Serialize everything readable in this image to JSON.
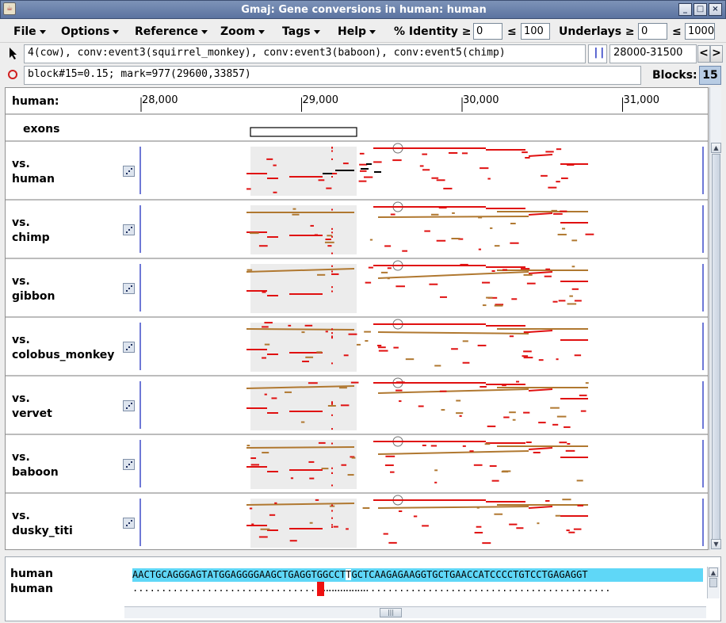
{
  "window": {
    "title": "Gmaj: Gene conversions in human: human",
    "app_icon": "java-cup-icon",
    "buttons": [
      "_",
      "□",
      "×"
    ]
  },
  "menubar": {
    "items": [
      "File",
      "Options",
      "Reference",
      "Zoom",
      "Tags",
      "Help"
    ],
    "identity": {
      "label": "% Identity",
      "ge": "≥",
      "le": "≤",
      "min": "0",
      "max": "100"
    },
    "underlays": {
      "label": "Underlays",
      "ge": "≥",
      "le": "≤",
      "min": "0",
      "max": "1000"
    }
  },
  "toolbar": {
    "info_text": "4(cow), conv:event3(squirrel_monkey), conv:event3(baboon), conv:event5(chimp)",
    "range_icon": "||",
    "range": "28000-31500",
    "prev": "<",
    "next": ">",
    "mark_text": "block#15=0.15; mark=977(29600,33857)",
    "blocks_label": "Blocks:",
    "blocks_value": "15"
  },
  "ruler": {
    "label": "human:",
    "ticks": [
      {
        "pos": 28000,
        "text": "28,000"
      },
      {
        "pos": 29000,
        "text": "29,000"
      },
      {
        "pos": 30000,
        "text": "30,000"
      },
      {
        "pos": 31000,
        "text": "31,000"
      }
    ]
  },
  "exons": {
    "label": "exons"
  },
  "rows": [
    {
      "vs": "vs.",
      "species": "human"
    },
    {
      "vs": "vs.",
      "species": "chimp"
    },
    {
      "vs": "vs.",
      "species": "gibbon"
    },
    {
      "vs": "vs.",
      "species": "colobus_monkey"
    },
    {
      "vs": "vs.",
      "species": "vervet"
    },
    {
      "vs": "vs.",
      "species": "baboon"
    },
    {
      "vs": "vs.",
      "species": "dusky_titi"
    }
  ],
  "sequence": {
    "row1_name": "human",
    "row2_name": "human",
    "seq_left": "AACTGCAGGGAGTATGGAGGGGAAGCTGAGGTGGCCT",
    "seq_right": "GCTCAAGAGAAGGTGCTGAACCATCCCCTGTCCTGAGAGGT",
    "dots_left": ".........................................",
    "dots_right": ".................................................."
  },
  "colors": {
    "match": "#e01010",
    "conversion": "#b07830",
    "highlight": "#5fd7f7",
    "axis": "#2030c0",
    "gray_box": "#ececec"
  }
}
